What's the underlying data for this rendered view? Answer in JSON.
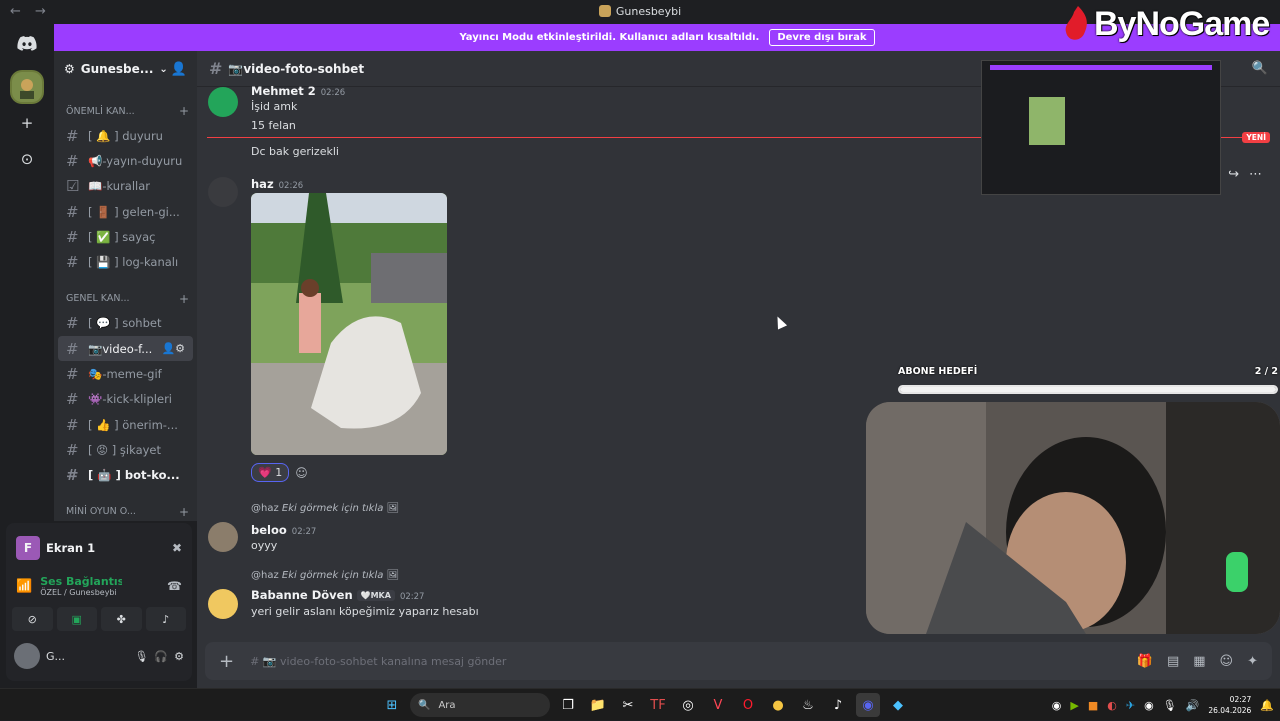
{
  "titlebar": {
    "back": "←",
    "forward": "→",
    "title": "Gunesbeybi"
  },
  "banner": {
    "text": "Yayıncı Modu etkinleştirildi. Kullanıcı adları kısaltıldı.",
    "button": "Devre dışı bırak"
  },
  "rail": {
    "home_icon": "discord-icon",
    "add": "+",
    "explore": "⊙"
  },
  "guild": {
    "name": "Gunesbe...",
    "chevron": "⌄"
  },
  "categories": [
    {
      "label": "ÖNEMLİ KAN...",
      "plus": "+"
    },
    {
      "label": "GENEL KAN...",
      "plus": "+"
    },
    {
      "label": "MİNİ OYUN O...",
      "plus": "+"
    }
  ],
  "channels_important": [
    {
      "label": "[ 🔔 ] duyuru"
    },
    {
      "label": "📢-yayın-duyuru"
    },
    {
      "label": "📖-kurallar"
    },
    {
      "label": "[ 🚪 ] gelen-gi..."
    },
    {
      "label": "[ ✅ ] sayaç"
    },
    {
      "label": "[ 💾 ] log-kanalı"
    }
  ],
  "channels_general": [
    {
      "label": "[ 💬 ] sohbet"
    },
    {
      "label": "📷video-f..."
    },
    {
      "label": "🎭-meme-gif"
    },
    {
      "label": "👾-kick-klipleri"
    },
    {
      "label": "[ 👍 ] önerim-..."
    },
    {
      "label": "[ 😡 ] şikayet"
    },
    {
      "label": "[ 🤖 ] bot-ko..."
    }
  ],
  "voice": {
    "screen_letter": "F",
    "screen_label": "Ekran 1",
    "connection": "Ses Bağlantısı K",
    "location": "ÖZEL / Gunesbeybi",
    "user_short": "G..."
  },
  "chat": {
    "channel": "📷video-foto-sohbet",
    "messages": [
      {
        "author": "Mehmet 2",
        "time": "02:26",
        "lines": [
          "İşid amk",
          "15 felan"
        ]
      },
      {
        "line": "Dc bak gerizekli"
      },
      {
        "author": "haz",
        "time": "02:26"
      },
      {
        "reply_to": "@haz",
        "reply_text": "Eki görmek için tıkla",
        "author": "beloo",
        "time": "02:27",
        "line": "oyyy"
      },
      {
        "reply_to": "@haz",
        "reply_text": "Eki görmek için tıkla",
        "author": "Babanne Döven",
        "badge": "🤍MKA",
        "time": "02:27",
        "line": "yeri gelir aslanı köpeğimiz yaparız hesabı"
      }
    ],
    "reaction": {
      "emoji": "💗",
      "count": "1"
    },
    "new_tag": "YENİ",
    "composer_placeholder": "# 📷 video-foto-sohbet kanalına mesaj gönder"
  },
  "overlay": {
    "logo": "ByNoGame",
    "goal_title": "ABONE HEDEFİ",
    "goal_value": "2 / 2",
    "goal_progress": 1.0
  },
  "taskbar": {
    "search": "Ara",
    "time": "02:27",
    "date": "26.04.2026"
  },
  "colors": {
    "banner": "#9b3dff",
    "accent_green": "#23a55a",
    "new_red": "#f23f43"
  }
}
